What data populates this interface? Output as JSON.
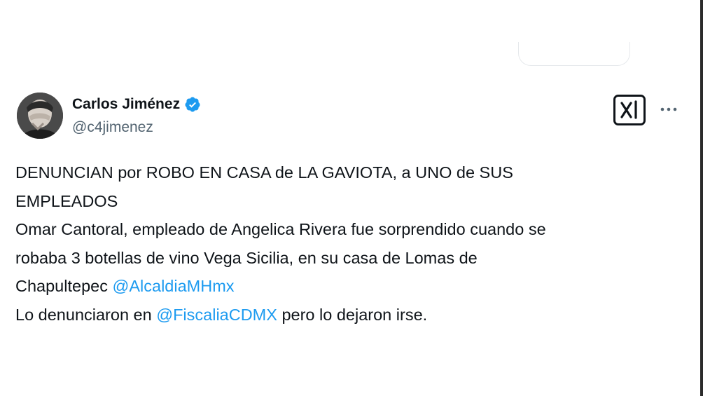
{
  "tweet": {
    "author": {
      "display_name": "Carlos Jiménez",
      "handle": "@c4jimenez",
      "verified": true,
      "verified_color": "#1d9bf0"
    },
    "text": {
      "line1": "DENUNCIAN por ROBO EN CASA de LA GAVIOTA, a UNO de SUS",
      "line2": "EMPLEADOS",
      "line3": "Omar Cantoral, empleado de Angelica Rivera fue sorprendido cuando se",
      "line4": "robaba 3 botellas de vino Vega Sicilia, en su casa de Lomas de",
      "line5_text": "Chapultepec ",
      "line5_mention": "@AlcaldiaMHmx",
      "line6_text_before": "Lo denunciaron en ",
      "line6_mention": "@FiscaliaCDMX",
      "line6_text_after": " pero lo dejaron irse."
    },
    "icons": {
      "grok": "grok-icon",
      "more": "more-icon",
      "verified": "verified-badge-icon"
    },
    "colors": {
      "text": "#0f1419",
      "secondary": "#536471",
      "link": "#1d9bf0"
    }
  }
}
